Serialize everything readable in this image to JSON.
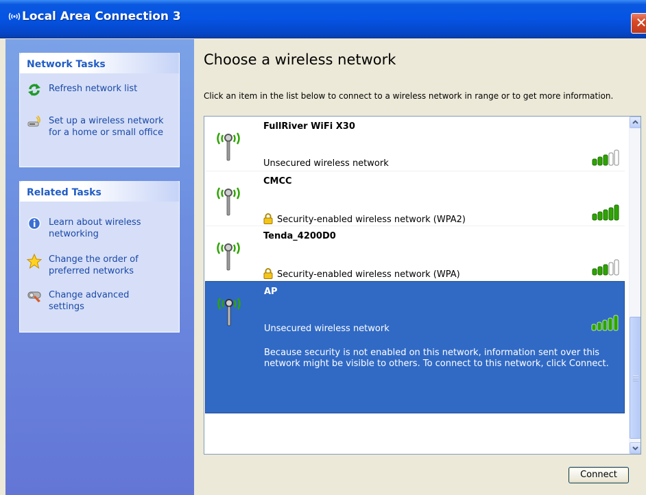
{
  "window": {
    "title": "Local Area Connection 3",
    "title_icon": "wireless-signal-icon",
    "close_label": "✕"
  },
  "left_pane": {
    "network_tasks": {
      "header": "Network Tasks",
      "items": [
        {
          "label": "Refresh network list",
          "icon": "refresh-icon"
        },
        {
          "label": "Set up a wireless network for a home or small office",
          "label_line1": "Set up a wireless network",
          "label_line2": "for a home or small office",
          "icon": "wireless-setup-icon"
        }
      ]
    },
    "related_tasks": {
      "header": "Related Tasks",
      "items": [
        {
          "label_line1": "Learn about wireless",
          "label_line2": "networking",
          "icon": "info-icon"
        },
        {
          "label_line1": "Change the order of",
          "label_line2": "preferred networks",
          "icon": "star-icon"
        },
        {
          "label_line1": "Change advanced",
          "label_line2": "settings",
          "icon": "advanced-settings-icon"
        }
      ]
    }
  },
  "main": {
    "title": "Choose a wireless network",
    "description": "Click an item in the list below to connect to a wireless network in range or to get more information.",
    "networks": [
      {
        "name": "FullRiver WiFi X30",
        "status": "Unsecured wireless network",
        "secured": false,
        "signal_bars": 3,
        "selected": false
      },
      {
        "name": "CMCC",
        "status": "Security-enabled wireless network (WPA2)",
        "secured": true,
        "signal_bars": 5,
        "selected": false
      },
      {
        "name": "Tenda_4200D0",
        "status": "Security-enabled wireless network (WPA)",
        "secured": true,
        "signal_bars": 3,
        "selected": false
      },
      {
        "name": "AP",
        "status": "Unsecured wireless network",
        "secured": false,
        "signal_bars": 5,
        "selected": true,
        "description": "Because security is not enabled on this network, information sent over this network might be visible to others. To connect to this network, click Connect."
      }
    ],
    "connect_label": "Connect"
  },
  "colors": {
    "title_bar": "#0554e3",
    "left_pane": "#6d8ee0",
    "task_link": "#1a48a8",
    "selection": "#316ac5",
    "signal_green": "#2ea400"
  }
}
